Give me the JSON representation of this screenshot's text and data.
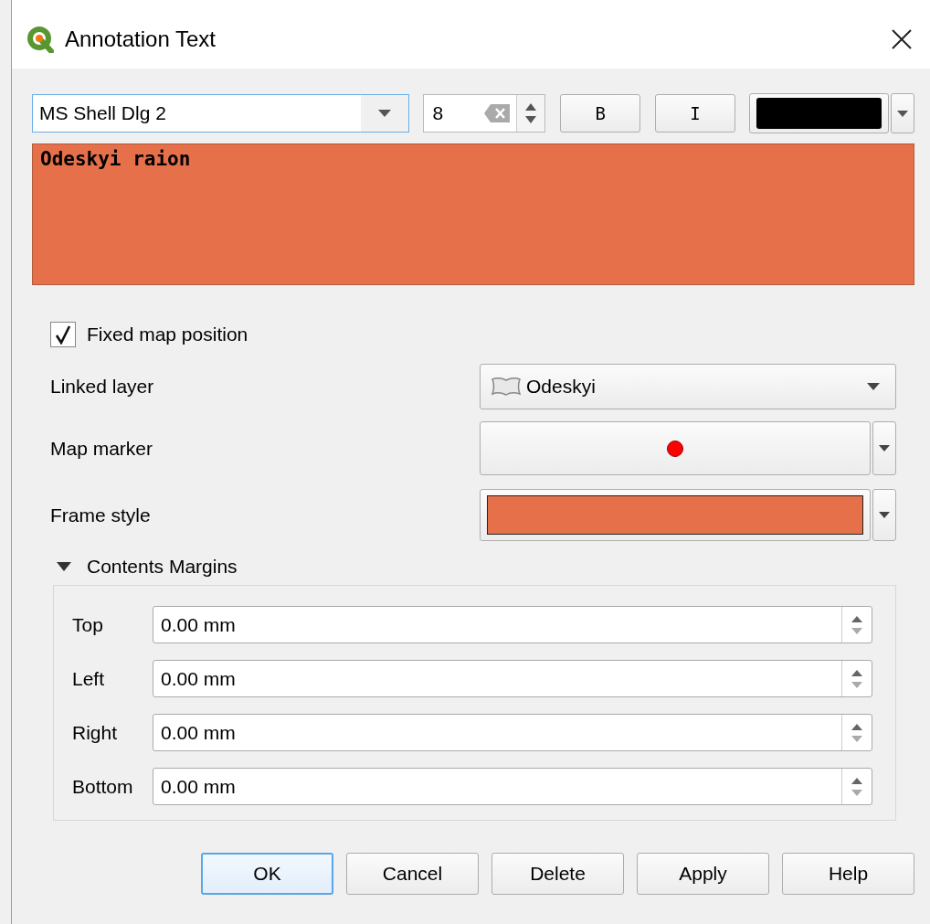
{
  "window": {
    "title": "Annotation Text"
  },
  "toolbar": {
    "font_family": "MS Shell Dlg 2",
    "font_size": "8",
    "bold_button": "B",
    "italic_button": "I",
    "text_color_button": {
      "color": "#000000"
    }
  },
  "annotation": {
    "text": "Odeskyi raion",
    "color": "#e5704a"
  },
  "fixed_map_position": {
    "label": "Fixed map position",
    "checked": true
  },
  "linked_layer": {
    "label": "Linked layer",
    "value": "Odeskyi"
  },
  "map_marker": {
    "label": "Map marker",
    "color": "#ff0000"
  },
  "frame_style": {
    "label": "Frame style",
    "color": "#e5704a"
  },
  "contents_margins": {
    "title": "Contents Margins",
    "expanded": true,
    "margins": [
      {
        "label": "Top",
        "value": "0.00 mm"
      },
      {
        "label": "Left",
        "value": "0.00 mm"
      },
      {
        "label": "Right",
        "value": "0.00 mm"
      },
      {
        "label": "Bottom",
        "value": "0.00 mm"
      }
    ]
  },
  "buttons": [
    {
      "label": "OK",
      "focused": true
    },
    {
      "label": "Cancel",
      "focused": false
    },
    {
      "label": "Delete",
      "focused": false
    },
    {
      "label": "Apply",
      "focused": false
    },
    {
      "label": "Help",
      "focused": false
    }
  ]
}
